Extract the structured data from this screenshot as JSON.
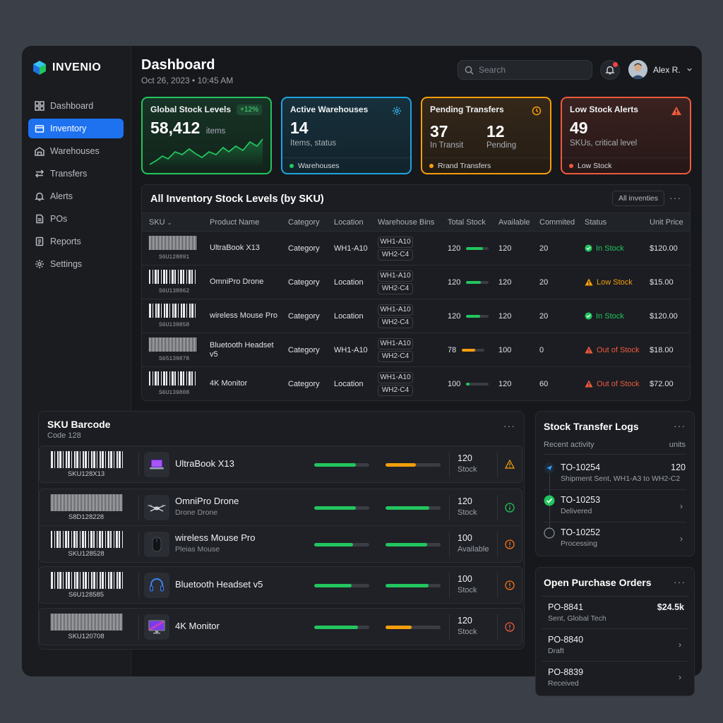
{
  "brand": {
    "name": "INVENIO"
  },
  "sidebar": {
    "items": [
      {
        "label": "Dashboard",
        "icon": "grid-icon"
      },
      {
        "label": "Inventory",
        "icon": "box-icon"
      },
      {
        "label": "Warehouses",
        "icon": "warehouse-icon"
      },
      {
        "label": "Transfers",
        "icon": "transfer-icon"
      },
      {
        "label": "Alerts",
        "icon": "bell-icon"
      },
      {
        "label": "POs",
        "icon": "document-icon"
      },
      {
        "label": "Reports",
        "icon": "report-icon"
      },
      {
        "label": "Settings",
        "icon": "gear-icon"
      }
    ]
  },
  "header": {
    "title": "Dashboard",
    "date": "Oct 26, 2023 • 10:45 AM",
    "search_placeholder": "Search",
    "user_name": "Alex R."
  },
  "cards": {
    "global": {
      "title": "Global Stock Levels",
      "badge": "+12%",
      "value": "58,412",
      "unit": "items",
      "color": "#22c55e"
    },
    "warehouses": {
      "title": "Active Warehouses",
      "value": "14",
      "sub": "Items, status",
      "foot": "Warehouses",
      "color": "#1fa3e0"
    },
    "transfers": {
      "title": "Pending Transfers",
      "value1": "37",
      "label1": "In Transit",
      "value2": "12",
      "label2": "Pending",
      "foot": "Rrand Transfers",
      "color": "#f59e0b"
    },
    "lowstock": {
      "title": "Low Stock Alerts",
      "value": "49",
      "sub": "SKUs, critical level",
      "foot": "Low Stock",
      "color": "#ef5a3c"
    }
  },
  "stock_table": {
    "title": "All Inventory Stock Levels (by SKU)",
    "filter": "All inventies",
    "columns": [
      "SKU",
      "Product Name",
      "Category",
      "Location",
      "Warehouse Bins",
      "Total Stock",
      "Available",
      "Commited",
      "Status",
      "Unit Price"
    ],
    "rows": [
      {
        "sku": "S6U128891",
        "name": "UltraBook X13",
        "category": "Category",
        "location": "WH1-A10",
        "bin1": "WH1-A10",
        "bin2": "WH2-C4",
        "total": "120",
        "fill": 0.75,
        "fill_color": "#22c55e",
        "available": "120",
        "committed": "20",
        "status": "In Stock",
        "status_color": "#22c55e",
        "price": "$120.00"
      },
      {
        "sku": "S6U138862",
        "name": "OmniPro Drone",
        "category": "Category",
        "location": "Location",
        "bin1": "WH1-A10",
        "bin2": "WH2-C4",
        "total": "120",
        "fill": 0.65,
        "fill_color": "#22c55e",
        "available": "120",
        "committed": "20",
        "status": "Low Stock",
        "status_color": "#f59e0b",
        "price": "$15.00"
      },
      {
        "sku": "S6U139858",
        "name": "wireless Mouse Pro",
        "category": "Category",
        "location": "Location",
        "bin1": "WH1-A10",
        "bin2": "WH2-C4",
        "total": "120",
        "fill": 0.6,
        "fill_color": "#22c55e",
        "available": "120",
        "committed": "20",
        "status": "In Stock",
        "status_color": "#22c55e",
        "price": "$120.00"
      },
      {
        "sku": "S65139878",
        "name": "Bluetooth Headset v5",
        "category": "Category",
        "location": "WH1-A10",
        "bin1": "WH1-A10",
        "bin2": "WH2-C4",
        "total": "78",
        "fill": 0.6,
        "fill_color": "#f59e0b",
        "available": "100",
        "committed": "0",
        "status": "Out of Stock",
        "status_color": "#ef5a3c",
        "price": "$18.00"
      },
      {
        "sku": "S6U139808",
        "name": "4K Monitor",
        "category": "Category",
        "location": "Location",
        "bin1": "WH1-A10",
        "bin2": "WH2-C4",
        "total": "100",
        "fill": 0.15,
        "fill_color": "#22c55e",
        "available": "120",
        "committed": "60",
        "status": "Out of Stock",
        "status_color": "#ef5a3c",
        "price": "$72.00"
      }
    ]
  },
  "barcode_panel": {
    "title": "SKU Barcode",
    "subtitle": "Code 128",
    "rows": [
      {
        "code": "SKU128X13",
        "name": "UltraBook X13",
        "desc": "",
        "bar1": 0.75,
        "bar1_color": "#22c55e",
        "bar2": 0.55,
        "bar2_color": "#f59e0b",
        "qty": "120",
        "qty_label": "Stock",
        "status_icon": "warning-icon",
        "status_color": "#f59e0b",
        "thumb": "laptop-icon"
      },
      {
        "code": "S8D128228",
        "name": "OmniPro Drone",
        "desc": "Drone Drone",
        "bar1": 0.75,
        "bar1_color": "#22c55e",
        "bar2": 0.8,
        "bar2_color": "#22c55e",
        "qty": "120",
        "qty_label": "Stock",
        "status_icon": "info-icon",
        "status_color": "#22c55e",
        "thumb": "drone-icon"
      },
      {
        "code": "SKU128528",
        "name": "wireless Mouse Pro",
        "desc": "Pleias Mouse",
        "bar1": 0.7,
        "bar1_color": "#22c55e",
        "bar2": 0.75,
        "bar2_color": "#22c55e",
        "qty": "100",
        "qty_label": "Available",
        "status_icon": "alert-icon",
        "status_color": "#f97316",
        "thumb": "mouse-icon"
      },
      {
        "code": "S6U128585",
        "name": "Bluetooth Headset v5",
        "desc": "",
        "bar1": 0.68,
        "bar1_color": "#22c55e",
        "bar2": 0.78,
        "bar2_color": "#22c55e",
        "qty": "100",
        "qty_label": "Stock",
        "status_icon": "alert-icon",
        "status_color": "#f97316",
        "thumb": "headset-icon"
      },
      {
        "code": "SKU120708",
        "name": "4K Monitor",
        "desc": "",
        "bar1": 0.8,
        "bar1_color": "#22c55e",
        "bar2": 0.48,
        "bar2_color": "#f59e0b",
        "qty": "120",
        "qty_label": "Stock",
        "status_icon": "alert-icon",
        "status_color": "#ef5a3c",
        "thumb": "monitor-icon"
      }
    ]
  },
  "transfer_logs": {
    "title": "Stock Transfer Logs",
    "left_label": "Recent activity",
    "right_label": "units",
    "items": [
      {
        "id": "TO-10254",
        "desc": "Shipment Sent, WH1-A3 to WH2-C2",
        "units": "120"
      },
      {
        "id": "TO-10253",
        "desc": "Delivered",
        "units": ""
      },
      {
        "id": "TO-10252",
        "desc": "Processing",
        "units": ""
      }
    ]
  },
  "purchase_orders": {
    "title": "Open Purchase Orders",
    "items": [
      {
        "id": "PO-8841",
        "desc": "Sent, Global Tech",
        "amount": "$24.5k"
      },
      {
        "id": "PO-8840",
        "desc": "Draft",
        "amount": ""
      },
      {
        "id": "PO-8839",
        "desc": "Received",
        "amount": ""
      }
    ]
  }
}
